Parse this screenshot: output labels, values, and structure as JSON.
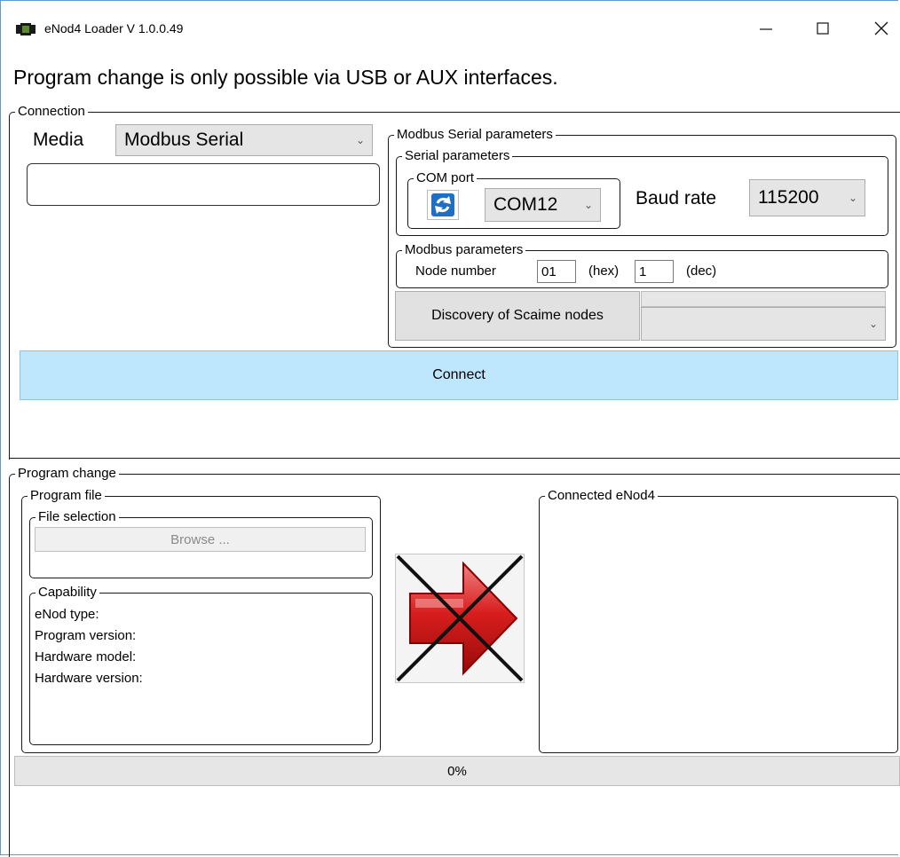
{
  "window": {
    "title": "eNod4 Loader V 1.0.0.49"
  },
  "message": "Program change is only possible via USB or AUX interfaces.",
  "connection": {
    "legend": "Connection",
    "media_label": "Media",
    "media_value": "Modbus Serial",
    "status_text": "",
    "modbus_serial": {
      "legend": "Modbus Serial parameters",
      "serial": {
        "legend": "Serial parameters",
        "com_port_legend": "COM port",
        "com_port_value": "COM12",
        "baud_label": "Baud rate",
        "baud_value": "115200"
      },
      "modbus": {
        "legend": "Modbus parameters",
        "node_label": "Node number",
        "node_hex": "01",
        "hex_label": "(hex)",
        "node_dec": "1",
        "dec_label": "(dec)"
      },
      "discovery_label": "Discovery of Scaime nodes",
      "discovery_value": ""
    },
    "connect_label": "Connect"
  },
  "program_change": {
    "legend": "Program change",
    "program_file": {
      "legend": "Program file",
      "file_selection_legend": "File selection",
      "browse_label": "Browse ...",
      "capability_legend": "Capability",
      "capability_lines": [
        "eNod type:",
        "Program version:",
        "Hardware model:",
        "Hardware version:"
      ]
    },
    "connected_legend": "Connected eNod4",
    "progress": {
      "value": 0,
      "text": "0%"
    }
  },
  "colors": {
    "connect_bg": "#bee6fd",
    "connect_border": "#8fc3e6",
    "window_border": "#5b9bd5",
    "arrow_red": "#d81e1e"
  },
  "icons": [
    "app-icon",
    "minimize-icon",
    "maximize-icon",
    "close-icon",
    "refresh-icon",
    "chevron-down-icon",
    "program-transfer-disabled-icon"
  ]
}
